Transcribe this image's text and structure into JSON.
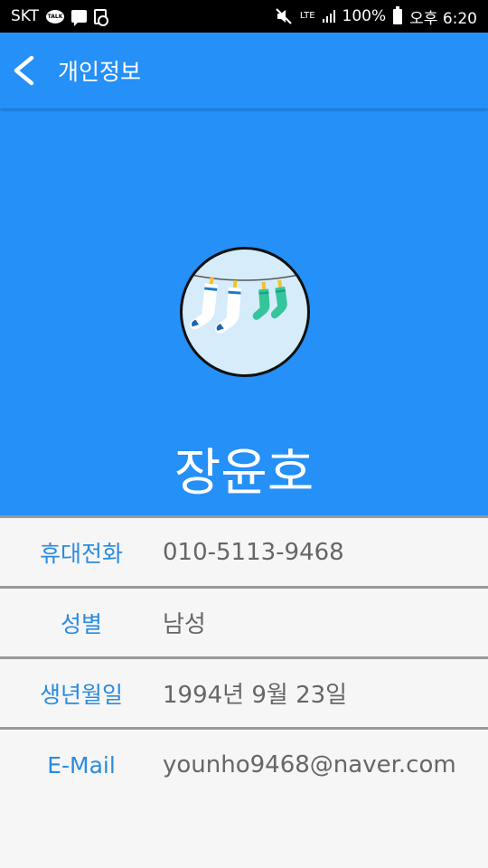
{
  "status_bar": {
    "carrier": "SKT",
    "talk_badge": "TALK",
    "network": "LTE",
    "battery": "100%",
    "time": "오후 6:20"
  },
  "app_bar": {
    "title": "개인정보",
    "back_icon": "chevron-left-icon"
  },
  "profile": {
    "name": "장윤호",
    "avatar_image": "socks-on-clothesline"
  },
  "info": [
    {
      "label": "휴대전화",
      "value": "010-5113-9468"
    },
    {
      "label": "성별",
      "value": "남성"
    },
    {
      "label": "생년월일",
      "value": "1994년 9월 23일"
    },
    {
      "label": "E-Mail",
      "value": "younho9468@naver.com"
    }
  ],
  "colors": {
    "primary": "#2490f8",
    "label": "#2a8be0",
    "value": "#666666",
    "divider": "#999999",
    "background": "#f6f6f6"
  }
}
